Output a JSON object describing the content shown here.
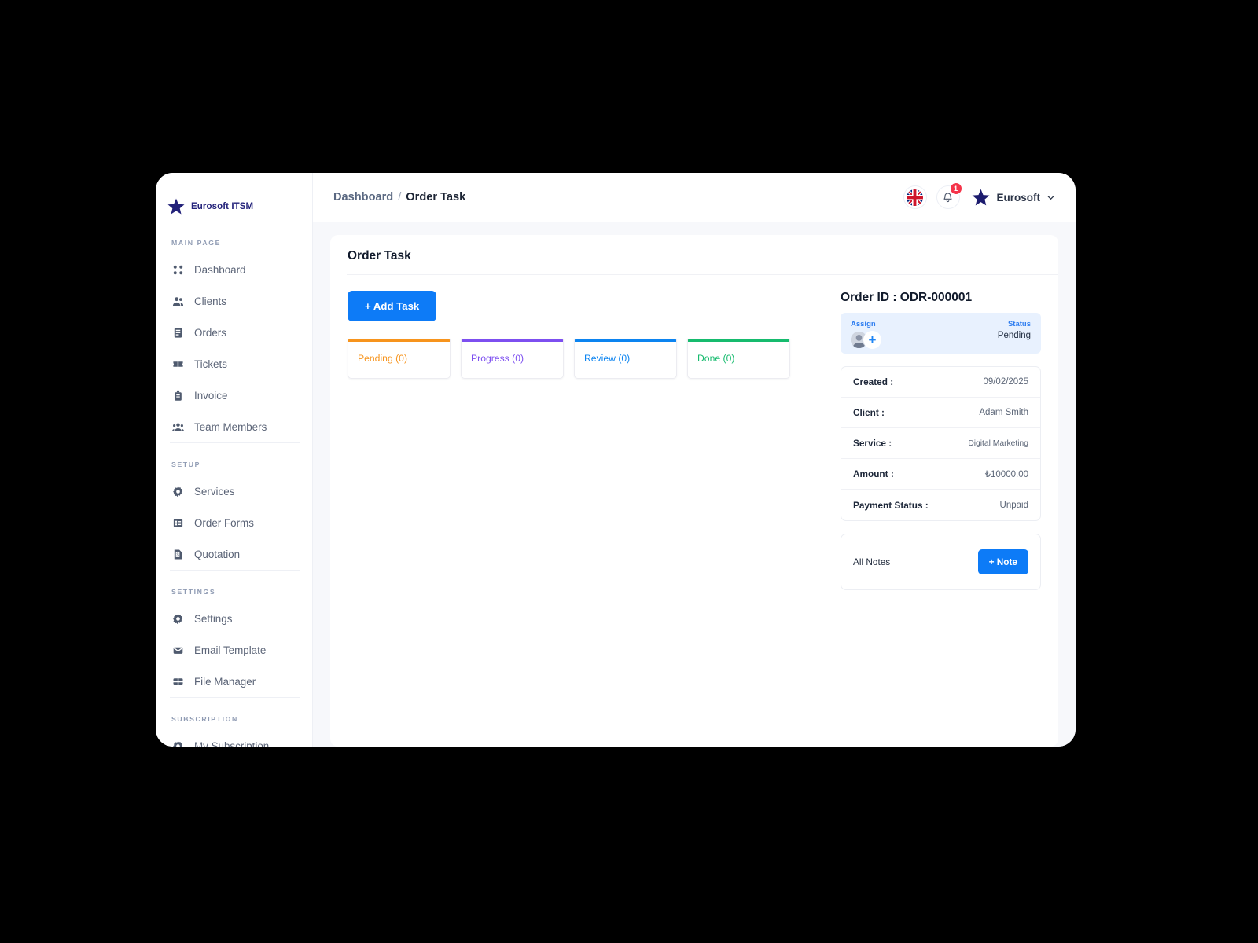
{
  "brand": {
    "name": "Eurosoft ITSM"
  },
  "sidebar": {
    "groups": [
      {
        "label": "MAIN PAGE",
        "items": [
          {
            "label": "Dashboard",
            "icon": "grid-dots-icon"
          },
          {
            "label": "Clients",
            "icon": "people-icon"
          },
          {
            "label": "Orders",
            "icon": "document-list-icon"
          },
          {
            "label": "Tickets",
            "icon": "ticket-icon"
          },
          {
            "label": "Invoice",
            "icon": "invoice-lock-icon"
          },
          {
            "label": "Team Members",
            "icon": "team-icon"
          }
        ]
      },
      {
        "label": "SETUP",
        "items": [
          {
            "label": "Services",
            "icon": "gear-icon"
          },
          {
            "label": "Order Forms",
            "icon": "form-list-icon"
          },
          {
            "label": "Quotation",
            "icon": "quote-document-icon"
          }
        ]
      },
      {
        "label": "SETTINGS",
        "items": [
          {
            "label": "Settings",
            "icon": "gear-icon"
          },
          {
            "label": "Email Template",
            "icon": "mail-icon"
          },
          {
            "label": "File Manager",
            "icon": "folder-grid-icon"
          }
        ]
      },
      {
        "label": "SUBSCRIPTION",
        "items": [
          {
            "label": "My Subscription",
            "icon": "gear-icon"
          }
        ]
      }
    ]
  },
  "topbar": {
    "breadcrumb": {
      "parent": "Dashboard",
      "separator": "/",
      "current": "Order Task"
    },
    "language_icon": "uk-flag-icon",
    "notification_icon": "bell-icon",
    "notification_count": "1",
    "user_name": "Eurosoft",
    "user_chevron": "chevron-down-icon"
  },
  "panel": {
    "title": "Order Task",
    "add_task_label": "+ Add Task",
    "kanban": [
      {
        "label": "Pending (0)",
        "color": "#f7941d"
      },
      {
        "label": "Progress (0)",
        "color": "#7d4ff0"
      },
      {
        "label": "Review (0)",
        "color": "#0c84f0"
      },
      {
        "label": "Done (0)",
        "color": "#16bb6e"
      }
    ]
  },
  "order": {
    "id_label": "Order ID : ODR-000001",
    "assign_label": "Assign",
    "assign_add_icon": "plus-icon",
    "status_label": "Status",
    "status_value": "Pending",
    "details": [
      {
        "key": "Created :",
        "value": "09/02/2025",
        "small": false
      },
      {
        "key": "Client :",
        "value": "Adam Smith",
        "small": false
      },
      {
        "key": "Service :",
        "value": "Digital Marketing",
        "small": true
      },
      {
        "key": "Amount :",
        "value": "₺10000.00",
        "small": false
      },
      {
        "key": "Payment Status :",
        "value": "Unpaid",
        "small": false
      }
    ],
    "notes_label": "All Notes",
    "note_button_label": "+ Note"
  }
}
